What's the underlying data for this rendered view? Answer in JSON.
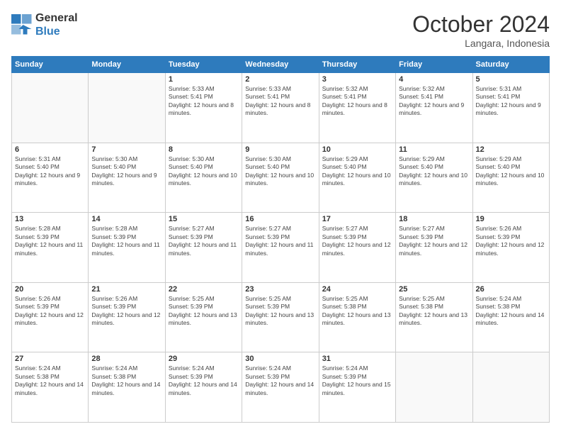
{
  "logo": {
    "line1": "General",
    "line2": "Blue"
  },
  "title": "October 2024",
  "location": "Langara, Indonesia",
  "weekdays": [
    "Sunday",
    "Monday",
    "Tuesday",
    "Wednesday",
    "Thursday",
    "Friday",
    "Saturday"
  ],
  "weeks": [
    [
      {
        "day": "",
        "info": ""
      },
      {
        "day": "",
        "info": ""
      },
      {
        "day": "1",
        "info": "Sunrise: 5:33 AM\nSunset: 5:41 PM\nDaylight: 12 hours and 8 minutes."
      },
      {
        "day": "2",
        "info": "Sunrise: 5:33 AM\nSunset: 5:41 PM\nDaylight: 12 hours and 8 minutes."
      },
      {
        "day": "3",
        "info": "Sunrise: 5:32 AM\nSunset: 5:41 PM\nDaylight: 12 hours and 8 minutes."
      },
      {
        "day": "4",
        "info": "Sunrise: 5:32 AM\nSunset: 5:41 PM\nDaylight: 12 hours and 9 minutes."
      },
      {
        "day": "5",
        "info": "Sunrise: 5:31 AM\nSunset: 5:41 PM\nDaylight: 12 hours and 9 minutes."
      }
    ],
    [
      {
        "day": "6",
        "info": "Sunrise: 5:31 AM\nSunset: 5:40 PM\nDaylight: 12 hours and 9 minutes."
      },
      {
        "day": "7",
        "info": "Sunrise: 5:30 AM\nSunset: 5:40 PM\nDaylight: 12 hours and 9 minutes."
      },
      {
        "day": "8",
        "info": "Sunrise: 5:30 AM\nSunset: 5:40 PM\nDaylight: 12 hours and 10 minutes."
      },
      {
        "day": "9",
        "info": "Sunrise: 5:30 AM\nSunset: 5:40 PM\nDaylight: 12 hours and 10 minutes."
      },
      {
        "day": "10",
        "info": "Sunrise: 5:29 AM\nSunset: 5:40 PM\nDaylight: 12 hours and 10 minutes."
      },
      {
        "day": "11",
        "info": "Sunrise: 5:29 AM\nSunset: 5:40 PM\nDaylight: 12 hours and 10 minutes."
      },
      {
        "day": "12",
        "info": "Sunrise: 5:29 AM\nSunset: 5:40 PM\nDaylight: 12 hours and 10 minutes."
      }
    ],
    [
      {
        "day": "13",
        "info": "Sunrise: 5:28 AM\nSunset: 5:39 PM\nDaylight: 12 hours and 11 minutes."
      },
      {
        "day": "14",
        "info": "Sunrise: 5:28 AM\nSunset: 5:39 PM\nDaylight: 12 hours and 11 minutes."
      },
      {
        "day": "15",
        "info": "Sunrise: 5:27 AM\nSunset: 5:39 PM\nDaylight: 12 hours and 11 minutes."
      },
      {
        "day": "16",
        "info": "Sunrise: 5:27 AM\nSunset: 5:39 PM\nDaylight: 12 hours and 11 minutes."
      },
      {
        "day": "17",
        "info": "Sunrise: 5:27 AM\nSunset: 5:39 PM\nDaylight: 12 hours and 12 minutes."
      },
      {
        "day": "18",
        "info": "Sunrise: 5:27 AM\nSunset: 5:39 PM\nDaylight: 12 hours and 12 minutes."
      },
      {
        "day": "19",
        "info": "Sunrise: 5:26 AM\nSunset: 5:39 PM\nDaylight: 12 hours and 12 minutes."
      }
    ],
    [
      {
        "day": "20",
        "info": "Sunrise: 5:26 AM\nSunset: 5:39 PM\nDaylight: 12 hours and 12 minutes."
      },
      {
        "day": "21",
        "info": "Sunrise: 5:26 AM\nSunset: 5:39 PM\nDaylight: 12 hours and 12 minutes."
      },
      {
        "day": "22",
        "info": "Sunrise: 5:25 AM\nSunset: 5:39 PM\nDaylight: 12 hours and 13 minutes."
      },
      {
        "day": "23",
        "info": "Sunrise: 5:25 AM\nSunset: 5:39 PM\nDaylight: 12 hours and 13 minutes."
      },
      {
        "day": "24",
        "info": "Sunrise: 5:25 AM\nSunset: 5:38 PM\nDaylight: 12 hours and 13 minutes."
      },
      {
        "day": "25",
        "info": "Sunrise: 5:25 AM\nSunset: 5:38 PM\nDaylight: 12 hours and 13 minutes."
      },
      {
        "day": "26",
        "info": "Sunrise: 5:24 AM\nSunset: 5:38 PM\nDaylight: 12 hours and 14 minutes."
      }
    ],
    [
      {
        "day": "27",
        "info": "Sunrise: 5:24 AM\nSunset: 5:38 PM\nDaylight: 12 hours and 14 minutes."
      },
      {
        "day": "28",
        "info": "Sunrise: 5:24 AM\nSunset: 5:38 PM\nDaylight: 12 hours and 14 minutes."
      },
      {
        "day": "29",
        "info": "Sunrise: 5:24 AM\nSunset: 5:39 PM\nDaylight: 12 hours and 14 minutes."
      },
      {
        "day": "30",
        "info": "Sunrise: 5:24 AM\nSunset: 5:39 PM\nDaylight: 12 hours and 14 minutes."
      },
      {
        "day": "31",
        "info": "Sunrise: 5:24 AM\nSunset: 5:39 PM\nDaylight: 12 hours and 15 minutes."
      },
      {
        "day": "",
        "info": ""
      },
      {
        "day": "",
        "info": ""
      }
    ]
  ]
}
